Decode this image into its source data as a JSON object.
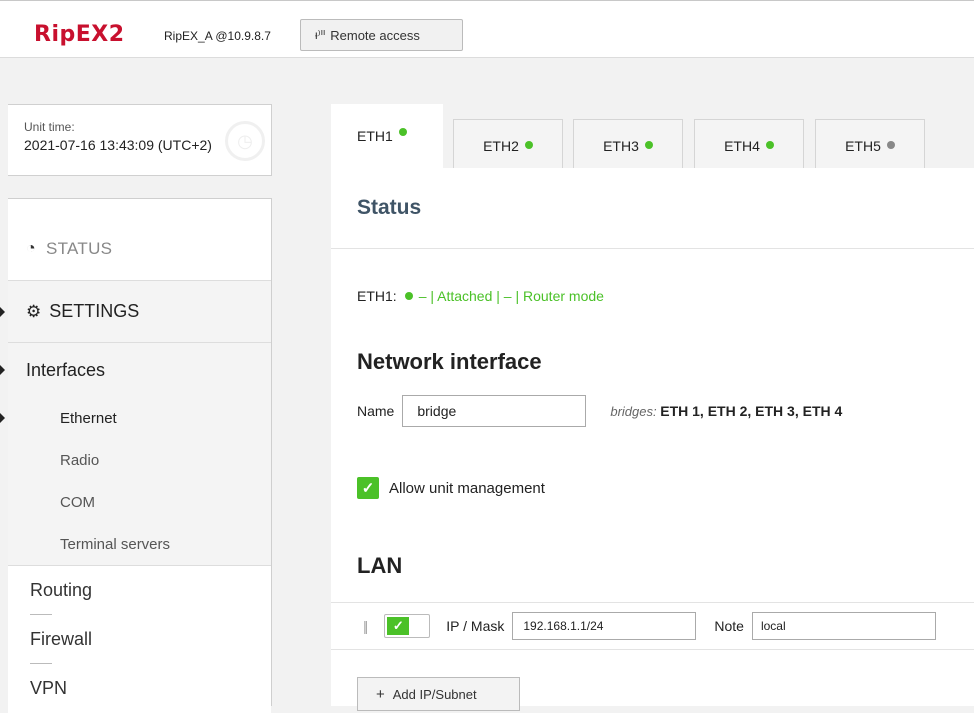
{
  "header": {
    "logo": "RipEX2",
    "unit_id": "RipEX_A @10.9.8.7",
    "remote_access_label": "Remote access"
  },
  "unit_time": {
    "label": "Unit time:",
    "value": "2021-07-16 13:43:09 (UTC+2)"
  },
  "sidebar": {
    "status": "STATUS",
    "settings": "SETTINGS",
    "interfaces": "Interfaces",
    "interface_items": [
      "Ethernet",
      "Radio",
      "COM",
      "Terminal servers"
    ],
    "other_items": [
      "Routing",
      "Firewall",
      "VPN"
    ]
  },
  "tabs": [
    {
      "label": "ETH1",
      "status": "green"
    },
    {
      "label": "ETH2",
      "status": "green"
    },
    {
      "label": "ETH3",
      "status": "green"
    },
    {
      "label": "ETH4",
      "status": "green"
    },
    {
      "label": "ETH5",
      "status": "gray"
    }
  ],
  "status": {
    "title": "Status",
    "eth_label": "ETH1:",
    "eth_status": "– | Attached | – | Router mode"
  },
  "network_interface": {
    "title": "Network interface",
    "name_label": "Name",
    "name_value": "bridge",
    "bridges_label": "bridges:",
    "bridges_value": "ETH 1, ETH 2, ETH 3, ETH 4",
    "allow_management_label": "Allow unit management",
    "allow_management_checked": true
  },
  "lan": {
    "title": "LAN",
    "rows": [
      {
        "ip_label": "IP / Mask",
        "ip_value": "192.168.1.1/24",
        "note_label": "Note",
        "note_value": "local",
        "enabled": true
      }
    ],
    "add_label": "Add IP/Subnet"
  },
  "colors": {
    "brand": "#c8102e",
    "ok": "#4bc128",
    "title": "#3f5466"
  }
}
